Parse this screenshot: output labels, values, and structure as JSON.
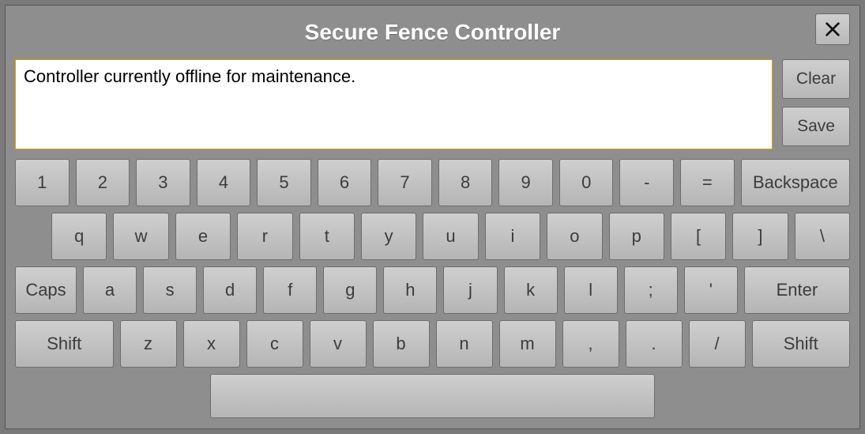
{
  "window": {
    "title": "Secure Fence Controller"
  },
  "input": {
    "value": "Controller currently offline for maintenance."
  },
  "buttons": {
    "clear": "Clear",
    "save": "Save"
  },
  "keys": {
    "row1": [
      "1",
      "2",
      "3",
      "4",
      "5",
      "6",
      "7",
      "8",
      "9",
      "0",
      "-",
      "="
    ],
    "backspace": "Backspace",
    "row2": [
      "q",
      "w",
      "e",
      "r",
      "t",
      "y",
      "u",
      "i",
      "o",
      "p",
      "[",
      "]",
      "\\"
    ],
    "caps": "Caps",
    "row3": [
      "a",
      "s",
      "d",
      "f",
      "g",
      "h",
      "j",
      "k",
      "l",
      ";",
      "'"
    ],
    "enter": "Enter",
    "shift_left": "Shift",
    "row4": [
      "z",
      "x",
      "c",
      "v",
      "b",
      "n",
      "m",
      ",",
      ".",
      "/"
    ],
    "shift_right": "Shift",
    "space": " "
  }
}
